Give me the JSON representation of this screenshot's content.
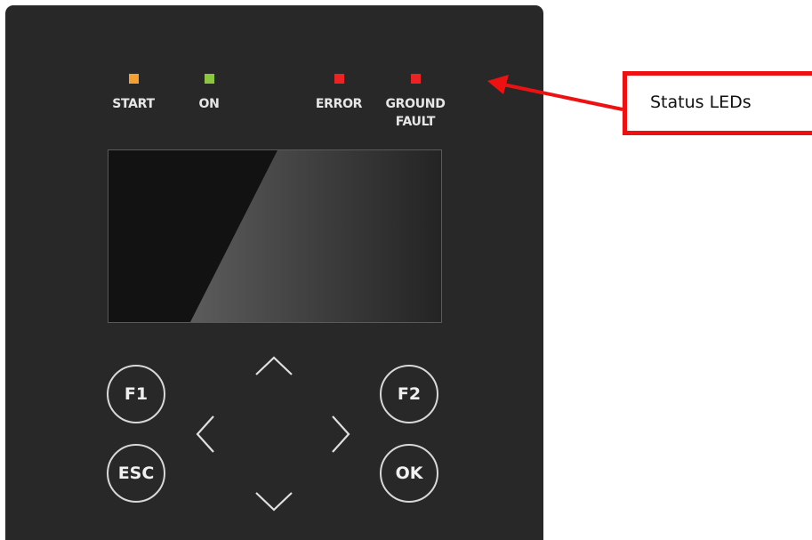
{
  "leds": [
    {
      "label": "START",
      "color": "#f7a030"
    },
    {
      "label": "ON",
      "color": "#8cc63f"
    },
    {
      "label": "ERROR",
      "color": "#ee2222"
    },
    {
      "label_line1": "GROUND",
      "label_line2": "FAULT",
      "color": "#ee2222"
    }
  ],
  "buttons": {
    "f1": "F1",
    "f2": "F2",
    "esc": "ESC",
    "ok": "OK"
  },
  "nav_icons": [
    "chevron-up-icon",
    "chevron-down-icon",
    "chevron-left-icon",
    "chevron-right-icon"
  ],
  "callout": {
    "text": "Status LEDs",
    "border_color": "#ee1111"
  },
  "colors": {
    "panel": "#282828",
    "screen": "#121212"
  }
}
